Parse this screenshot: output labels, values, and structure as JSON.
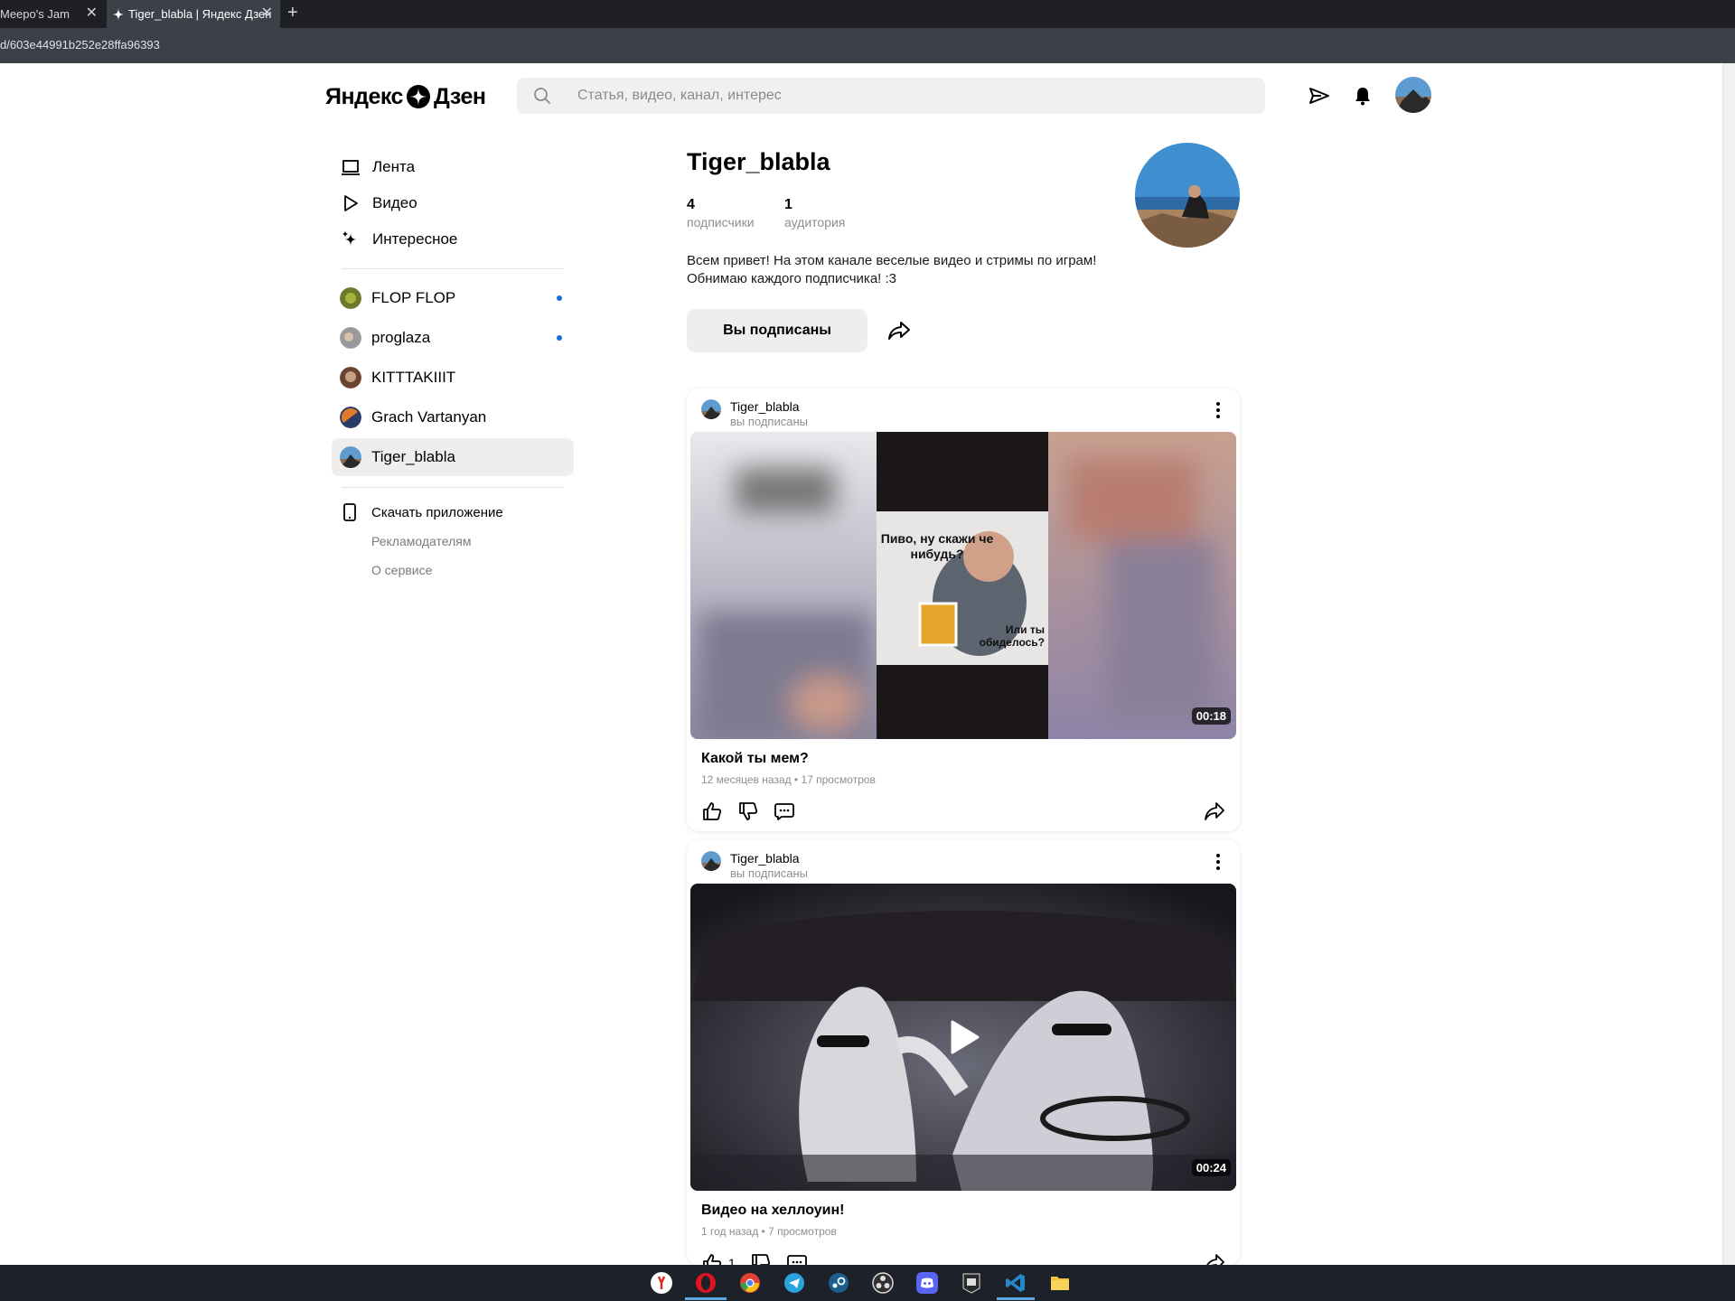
{
  "browser": {
    "tabs": [
      {
        "label": "Meepo's Jam"
      },
      {
        "label": "Tiger_blabla | Яндекс Дзен"
      }
    ],
    "url": "d/603e44991b252e28ffa96393",
    "new_tab_label": "+"
  },
  "header": {
    "logo_left": "Яндекс",
    "logo_right": "Дзен",
    "search_placeholder": "Статья, видео, канал, интерес"
  },
  "sidebar": {
    "nav": [
      {
        "label": "Лента",
        "icon": "feed-icon"
      },
      {
        "label": "Видео",
        "icon": "video-play-icon"
      },
      {
        "label": "Интересное",
        "icon": "sparkle-icon"
      }
    ],
    "subscriptions": [
      {
        "label": "FLOP FLOP",
        "has_new": true,
        "color": "#6d7a2a"
      },
      {
        "label": "proglaza",
        "has_new": true,
        "color": "#8a8a8a"
      },
      {
        "label": "KITTTAKIIIT",
        "has_new": false,
        "color": "#8a5a3c"
      },
      {
        "label": "Grach Vartanyan",
        "has_new": false,
        "color": "#b85a2a"
      },
      {
        "label": "Tiger_blabla",
        "has_new": false,
        "color": "#3e7fb3",
        "active": true
      }
    ],
    "app_link": "Скачать приложение",
    "footer": [
      "Рекламодателям",
      "О сервисе"
    ]
  },
  "channel": {
    "name": "Tiger_blabla",
    "subscribers": {
      "value": "4",
      "label": "подписчики"
    },
    "audience": {
      "value": "1",
      "label": "аудитория"
    },
    "description": [
      "Всем привет! На этом канале веселые видео и стримы по играм!",
      "Обнимаю каждого подписчика! :3"
    ],
    "subscribe_label": "Вы подписаны"
  },
  "posts": [
    {
      "author": "Tiger_blabla",
      "author_sub": "вы подписаны",
      "duration": "00:18",
      "meme_text_top": "Пиво, ну скажи че нибудь?",
      "meme_text_bottom": "Или ты обиделось?",
      "title": "Какой ты мем?",
      "meta": "12 месяцев назад • 17 просмотров"
    },
    {
      "author": "Tiger_blabla",
      "author_sub": "вы подписаны",
      "duration": "00:24",
      "title": "Видео на хеллоуин!",
      "meta": "1 год назад • 7 просмотров",
      "likes": "1"
    }
  ],
  "taskbar": {
    "apps": [
      "yandex-browser-icon",
      "opera-icon",
      "chrome-icon",
      "telegram-icon",
      "steam-icon",
      "obs-icon",
      "discord-icon",
      "epic-games-icon",
      "vscode-icon",
      "file-explorer-icon"
    ]
  },
  "colors": {
    "accent_dot": "#1d6cd6",
    "active_bg": "#efeeec",
    "chrome_dark": "#1e2024",
    "chrome_mid": "#3b4049"
  }
}
